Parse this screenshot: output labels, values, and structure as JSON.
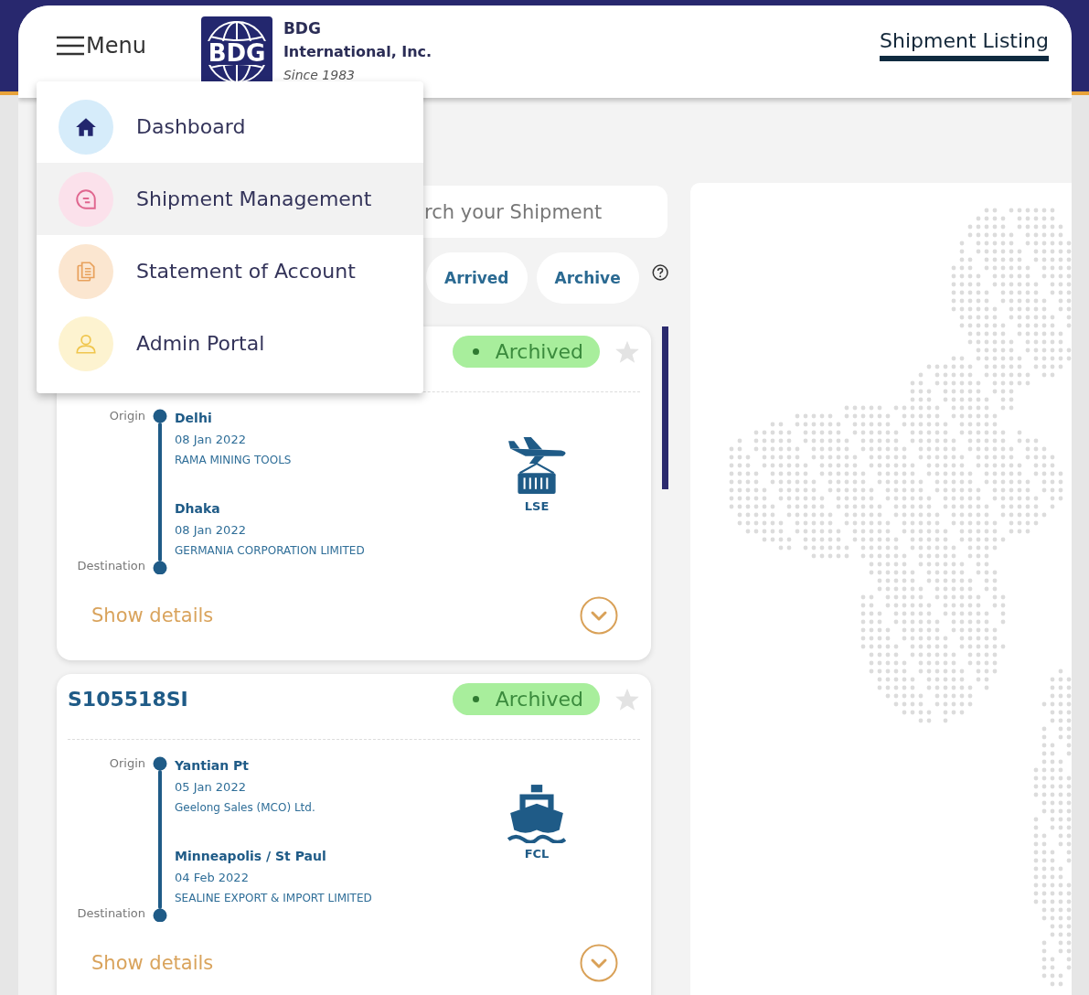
{
  "header": {
    "menu_label": "Menu",
    "logo": {
      "mark": "BDG",
      "name": "BDG",
      "subtitle": "International, Inc.",
      "tagline": "Since 1983"
    },
    "page_title": "Shipment Listing"
  },
  "nav_menu": {
    "items": [
      {
        "label": "Dashboard",
        "kind": "home",
        "selected": false
      },
      {
        "label": "Shipment Management",
        "kind": "chat",
        "selected": true
      },
      {
        "label": "Statement of Account",
        "kind": "document",
        "selected": false
      },
      {
        "label": "Admin Portal",
        "kind": "person",
        "selected": false
      }
    ]
  },
  "search": {
    "placeholder": "rch your Shipment"
  },
  "filters": [
    {
      "label": "Arrived",
      "selected": false
    },
    {
      "label": "Archive",
      "selected": false
    }
  ],
  "shipments": [
    {
      "status": "Archived",
      "starred": false,
      "origin_label": "Origin",
      "destination_label": "Destination",
      "origin": {
        "city": "Delhi",
        "date": "08 Jan 2022",
        "company": "RAMA MINING TOOLS"
      },
      "destination": {
        "city": "Dhaka",
        "date": "08 Jan 2022",
        "company": "GERMANIA CORPORATION LIMITED"
      },
      "mode": {
        "kind": "air",
        "label": "LSE"
      },
      "details_label": "Show details"
    },
    {
      "id": "S105518SI",
      "status": "Archived",
      "starred": false,
      "origin_label": "Origin",
      "destination_label": "Destination",
      "origin": {
        "city": "Yantian Pt",
        "date": "05 Jan 2022",
        "company": "Geelong Sales (MCO) Ltd."
      },
      "destination": {
        "city": "Minneapolis / St Paul",
        "date": "04 Feb 2022",
        "company": "SEALINE EXPORT & IMPORT LIMITED"
      },
      "mode": {
        "kind": "sea",
        "label": "FCL"
      },
      "details_label": "Show details"
    }
  ]
}
